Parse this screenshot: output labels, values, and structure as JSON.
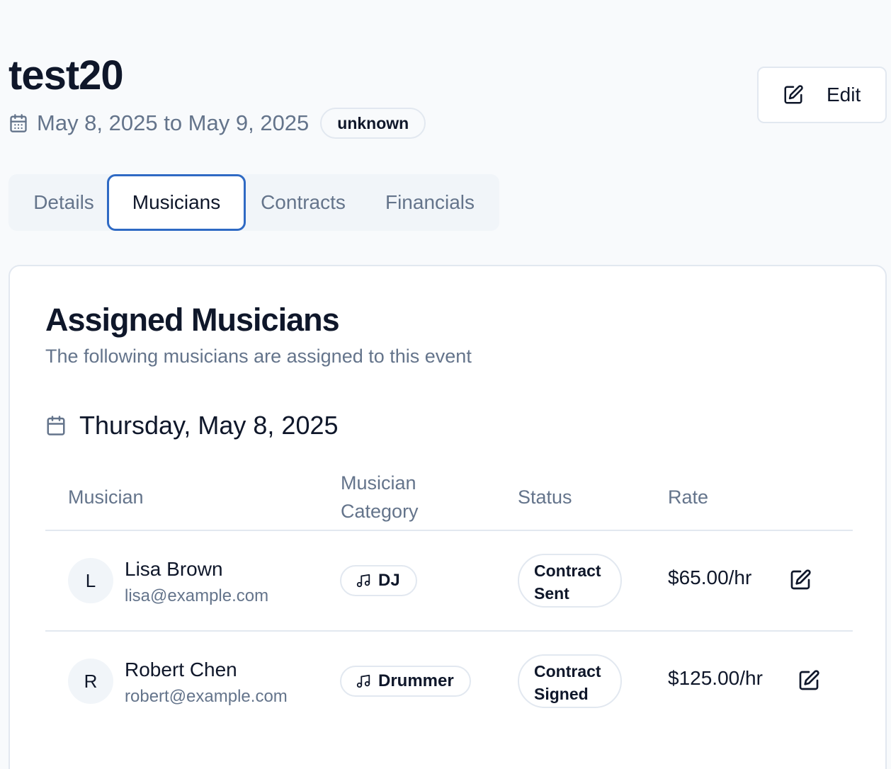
{
  "event": {
    "title": "test20",
    "date_range": "May 8, 2025 to May 9, 2025",
    "status": "unknown",
    "edit_label": "Edit"
  },
  "tabs": [
    {
      "label": "Details",
      "active": false
    },
    {
      "label": "Musicians",
      "active": true
    },
    {
      "label": "Contracts",
      "active": false
    },
    {
      "label": "Financials",
      "active": false
    }
  ],
  "musicians_card": {
    "title": "Assigned Musicians",
    "subtitle": "The following musicians are assigned to this event",
    "day_label": "Thursday, May 8, 2025",
    "columns": {
      "musician": "Musician",
      "category_line1": "Musician",
      "category_line2": "Category",
      "status": "Status",
      "rate": "Rate"
    },
    "rows": [
      {
        "initial": "L",
        "name": "Lisa Brown",
        "email": "lisa@example.com",
        "category": "DJ",
        "status_line1": "Contract",
        "status_line2": "Sent",
        "rate": "$65.00/hr"
      },
      {
        "initial": "R",
        "name": "Robert Chen",
        "email": "robert@example.com",
        "category": "Drummer",
        "status_line1": "Contract",
        "status_line2": "Signed",
        "rate": "$125.00/hr"
      }
    ]
  },
  "icons": {
    "calendar": "calendar-icon",
    "edit": "pencil-square-icon",
    "music": "music-note-icon"
  },
  "colors": {
    "accent": "#2f6ac4",
    "text": "#0f172a",
    "muted": "#64748b",
    "border": "#e2e8f0",
    "background": "#f8fafc"
  }
}
